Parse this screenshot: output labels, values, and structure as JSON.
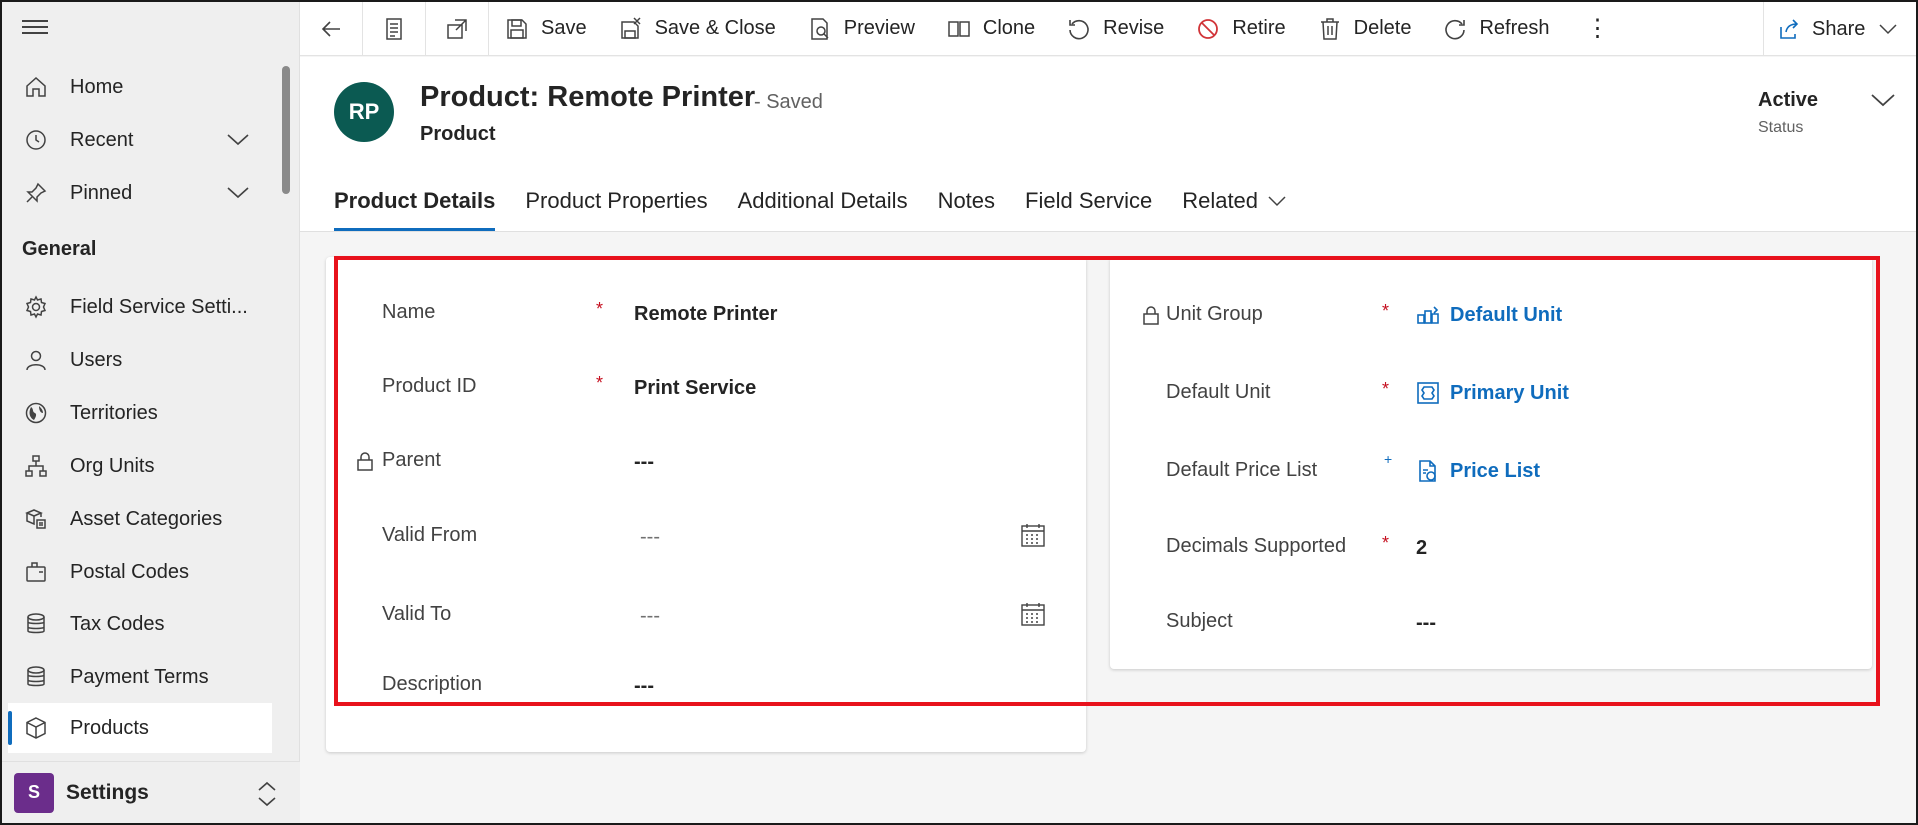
{
  "sidebar": {
    "items": [
      {
        "label": "Home",
        "icon": "home-icon"
      },
      {
        "label": "Recent",
        "icon": "clock-icon"
      },
      {
        "label": "Pinned",
        "icon": "pin-icon"
      },
      {
        "label": "Field Service Setti...",
        "icon": "gear-icon"
      },
      {
        "label": "Users",
        "icon": "person-icon"
      },
      {
        "label": "Territories",
        "icon": "globe-icon"
      },
      {
        "label": "Org Units",
        "icon": "org-chart-icon"
      },
      {
        "label": "Asset Categories",
        "icon": "asset-category-icon"
      },
      {
        "label": "Postal Codes",
        "icon": "postal-code-icon"
      },
      {
        "label": "Tax Codes",
        "icon": "database-icon"
      },
      {
        "label": "Payment Terms",
        "icon": "database-icon"
      },
      {
        "label": "Products",
        "icon": "box-icon"
      }
    ],
    "section_label": "General",
    "area": {
      "badge": "S",
      "label": "Settings"
    }
  },
  "toolbar": {
    "save": "Save",
    "save_close": "Save & Close",
    "preview": "Preview",
    "clone": "Clone",
    "revise": "Revise",
    "retire": "Retire",
    "delete": "Delete",
    "refresh": "Refresh",
    "more": "⋮",
    "share": "Share"
  },
  "header": {
    "avatar": "RP",
    "title": "Product: Remote Printer",
    "saved": "- Saved",
    "entity": "Product",
    "status_value": "Active",
    "status_label": "Status"
  },
  "tabs": [
    "Product Details",
    "Product Properties",
    "Additional Details",
    "Notes",
    "Field Service",
    "Related"
  ],
  "left_fields": {
    "name": {
      "label": "Name",
      "required": "*",
      "value": "Remote Printer"
    },
    "product_id": {
      "label": "Product ID",
      "required": "*",
      "value": "Print Service"
    },
    "parent": {
      "label": "Parent",
      "value": "---"
    },
    "valid_from": {
      "label": "Valid From",
      "value": "---"
    },
    "valid_to": {
      "label": "Valid To",
      "value": "---"
    },
    "description": {
      "label": "Description",
      "value": "---"
    }
  },
  "right_fields": {
    "unit_group": {
      "label": "Unit Group",
      "required": "*",
      "value": "Default Unit"
    },
    "default_unit": {
      "label": "Default Unit",
      "required": "*",
      "value": "Primary Unit"
    },
    "price_list": {
      "label": "Default Price List",
      "recommended": "+",
      "value": "Price List"
    },
    "decimals": {
      "label": "Decimals Supported",
      "required": "*",
      "value": "2"
    },
    "subject": {
      "label": "Subject",
      "value": "---"
    }
  },
  "colors": {
    "accent": "#0f6cbd",
    "highlight": "#e8121c",
    "avatar": "#0b5a52",
    "area_badge": "#6b2d8b"
  }
}
